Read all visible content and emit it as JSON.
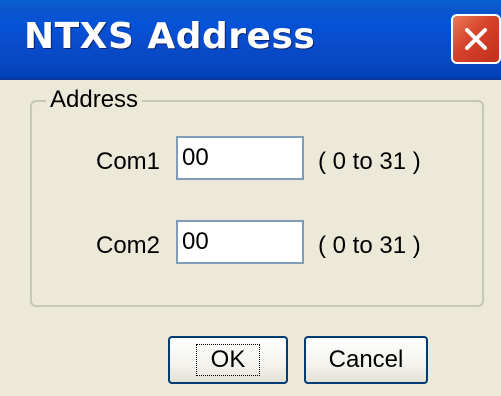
{
  "window": {
    "title": "NTXS Address"
  },
  "group": {
    "label": "Address"
  },
  "fields": [
    {
      "label": "Com1",
      "value": "00",
      "range": "( 0 to 31 )"
    },
    {
      "label": "Com2",
      "value": "00",
      "range": "( 0 to 31 )"
    }
  ],
  "buttons": {
    "ok_label": "OK",
    "cancel_label": "Cancel"
  },
  "icons": {
    "close": "close-icon"
  },
  "colors": {
    "titlebar": "#0453d8",
    "close_button": "#d6412a",
    "dialog_background": "#ece9d8"
  }
}
